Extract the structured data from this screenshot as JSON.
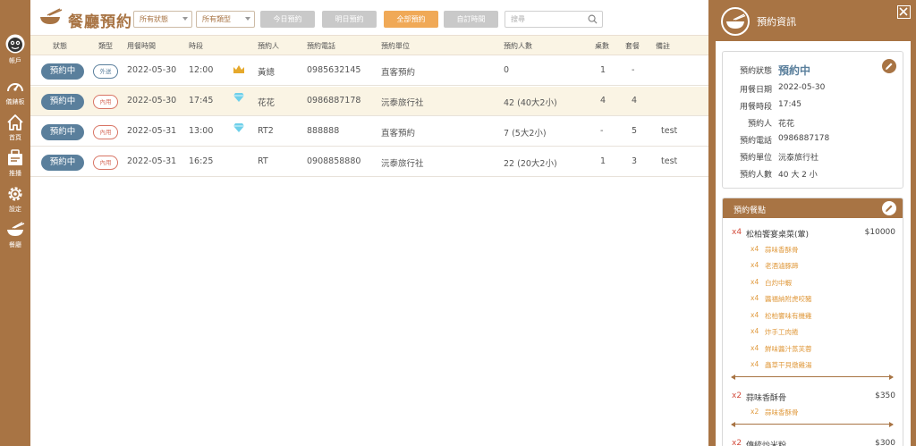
{
  "sidebar": {
    "items": [
      {
        "label": "帳戶",
        "icon": "user-avatar-icon"
      },
      {
        "label": "儀錶板",
        "icon": "dashboard-gauge-icon"
      },
      {
        "label": "首頁",
        "icon": "home-icon"
      },
      {
        "label": "推播",
        "icon": "push-notification-icon"
      },
      {
        "label": "設定",
        "icon": "gear-icon"
      },
      {
        "label": "餐廳",
        "icon": "dining-bowl-icon"
      }
    ]
  },
  "toolbar": {
    "title": "餐廳預約",
    "status_filter": "所有狀態",
    "type_filter": "所有類型",
    "btn_today": "今日預約",
    "btn_tomorrow": "明日預約",
    "btn_all": "全部預約",
    "btn_custom": "自訂時間",
    "search_placeholder": "搜尋"
  },
  "table": {
    "headers": [
      "狀態",
      "類型",
      "用餐時間",
      "時段",
      "預約人",
      "預約電話",
      "預約單位",
      "預約人數",
      "桌數",
      "套餐",
      "備註"
    ],
    "rows": [
      {
        "status": "預約中",
        "type": "外送",
        "type_kind": "out",
        "date": "2022-05-30",
        "time": "12:00",
        "tag": "crown",
        "name": "黃總",
        "phone": "0985632145",
        "unit": "直客預約",
        "guests": "0",
        "tables": "1",
        "sets": "-",
        "note": ""
      },
      {
        "status": "預約中",
        "type": "內用",
        "type_kind": "in",
        "date": "2022-05-30",
        "time": "17:45",
        "tag": "diamond",
        "name": "花花",
        "phone": "0986887178",
        "unit": "沅泰旅行社",
        "guests": "42 (40大2小)",
        "tables": "4",
        "sets": "4",
        "note": ""
      },
      {
        "status": "預約中",
        "type": "內用",
        "type_kind": "in",
        "date": "2022-05-31",
        "time": "13:00",
        "tag": "diamond",
        "name": "RT2",
        "phone": "888888",
        "unit": "直客預約",
        "guests": "7 (5大2小)",
        "tables": "-",
        "sets": "5",
        "note": "test"
      },
      {
        "status": "預約中",
        "type": "內用",
        "type_kind": "in",
        "date": "2022-05-31",
        "time": "16:25",
        "tag": "",
        "name": "RT",
        "phone": "0908858880",
        "unit": "沅泰旅行社",
        "guests": "22 (20大2小)",
        "tables": "1",
        "sets": "3",
        "note": "test"
      }
    ]
  },
  "panel": {
    "title": "預約資訊",
    "info": {
      "status_label": "預約狀態",
      "status_value": "預約中",
      "date_label": "用餐日期",
      "date_value": "2022-05-30",
      "time_label": "用餐時段",
      "time_value": "17:45",
      "name_label": "預約人",
      "name_value": "花花",
      "phone_label": "預約電話",
      "phone_value": "0986887178",
      "unit_label": "預約單位",
      "unit_value": "沅泰旅行社",
      "guests_label": "預約人數",
      "guests_value": "40 大 2 小"
    },
    "menu": {
      "title": "預約餐點",
      "groups": [
        {
          "qty": "x4",
          "name": "松柏饗宴桌菜(葷)",
          "price": "$10000",
          "subs": [
            {
              "qty": "x4",
              "name": "蒜味香酥骨"
            },
            {
              "qty": "x4",
              "name": "老酒滷豚蹄"
            },
            {
              "qty": "x4",
              "name": "白灼中蝦"
            },
            {
              "qty": "x4",
              "name": "醬福納附虎咬豬"
            },
            {
              "qty": "x4",
              "name": "松柏饗味有機雞"
            },
            {
              "qty": "x4",
              "name": "炸手工肉捲"
            },
            {
              "qty": "x4",
              "name": "鮮味醬汁蒸芙蓉"
            },
            {
              "qty": "x4",
              "name": "蟲草干貝燉雞湯"
            }
          ]
        },
        {
          "qty": "x2",
          "name": "蒜味香酥骨",
          "price": "$350",
          "subs": [
            {
              "qty": "x2",
              "name": "蒜味香酥骨"
            }
          ]
        },
        {
          "qty": "x2",
          "name": "傳統炒米粉",
          "price": "$300",
          "subs": []
        }
      ]
    }
  },
  "colors": {
    "brand": "#a87444",
    "status_pill": "#5a7f9c",
    "active_button": "#f0a957",
    "inactive_button": "#c9c9c9",
    "highlight_row": "#faf4e4",
    "qty_red": "#d34d3d",
    "sub_item": "#e09a3e"
  }
}
